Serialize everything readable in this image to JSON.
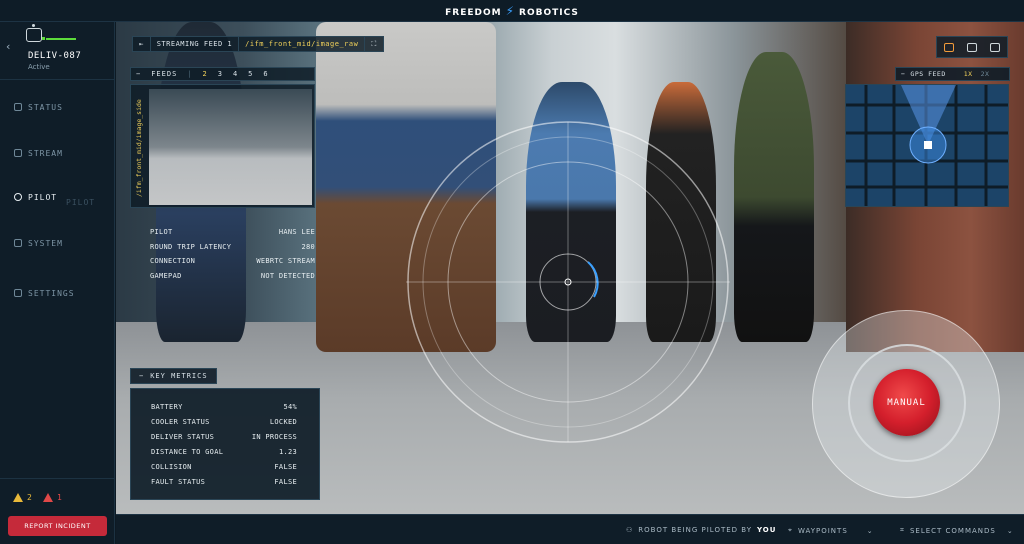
{
  "brand": {
    "left": "FREEDOM",
    "right": "ROBOTICS"
  },
  "robot": {
    "name": "DELIV-087",
    "status": "Active"
  },
  "nav": {
    "status": "STATUS",
    "stream": "STREAM",
    "pilot": "PILOT",
    "system": "SYSTEM",
    "settings": "SETTINGS",
    "ghost_pilot": "PILOT"
  },
  "alerts": {
    "warnings": "2",
    "errors": "1"
  },
  "report_incident": "REPORT INCIDENT",
  "stream": {
    "label": "STREAMING FEED 1",
    "topic": "/ifm_front_mid/image_raw"
  },
  "feeds": {
    "label": "FEEDS",
    "numbers": [
      "2",
      "3",
      "4",
      "5",
      "6"
    ],
    "side_topic": "/ifm_front_mid/image_side"
  },
  "info": {
    "rows": [
      {
        "k": "PILOT",
        "v": "HANS LEE"
      },
      {
        "k": "ROUND TRIP LATENCY",
        "v": "280"
      },
      {
        "k": "CONNECTION",
        "v": "WEBRTC STREAM"
      },
      {
        "k": "GAMEPAD",
        "v": "NOT DETECTED"
      }
    ]
  },
  "gps": {
    "label": "GPS FEED",
    "zoom1": "1X",
    "zoom2": "2X"
  },
  "metrics": {
    "title": "KEY METRICS",
    "rows": [
      {
        "k": "BATTERY",
        "v": "54%"
      },
      {
        "k": "COOLER STATUS",
        "v": "LOCKED"
      },
      {
        "k": "DELIVER STATUS",
        "v": "IN PROCESS"
      },
      {
        "k": "DISTANCE TO GOAL",
        "v": "1.23"
      },
      {
        "k": "COLLISION",
        "v": "FALSE"
      },
      {
        "k": "FAULT STATUS",
        "v": "FALSE"
      }
    ]
  },
  "manual_label": "MANUAL",
  "bottom": {
    "piloted_prefix": "ROBOT BEING PILOTED BY",
    "piloted_by": "YOU",
    "waypoints": "WAYPOINTS",
    "select_commands": "SELECT COMMANDS"
  },
  "icons": {
    "back": "chevron-left-icon",
    "robot": "robot-icon",
    "camera": "camera-icon",
    "bolt": "bolt-icon"
  },
  "colors": {
    "accent": "#f2d25a",
    "battery": "#5ddc3b",
    "danger": "#c52a3a",
    "manual": "#d41f2c"
  }
}
